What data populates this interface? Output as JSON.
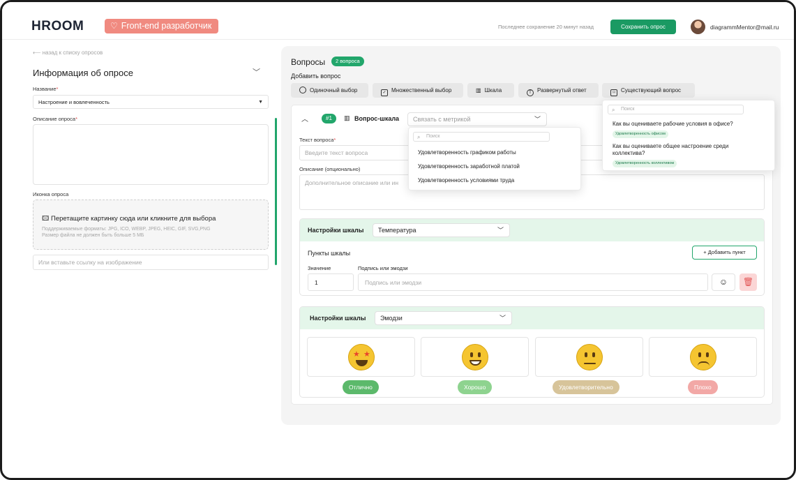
{
  "header": {
    "logo": "HRООМ",
    "project_badge": "Front-end разработчик",
    "last_save": "Последнее сохранение 20 минут назад",
    "save_button": "Сохранить опрос",
    "user_email": "diagrammMentor@mail.ru"
  },
  "sidebar": {
    "back_link": "назад к списку опросов",
    "section_title": "Информация об опросе",
    "name_label": "Название",
    "name_value": "Настроение и вовлеченность",
    "description_label": "Описание опроса",
    "icon_label": "Иконка опроса",
    "dropzone_title": "Перетащите картинку сюда или кликните для выбора",
    "dropzone_formats": "Поддерживаемые форматы: JPG, ICO, WEBP, JPEG, HEIC, GIF, SVG,PNG",
    "dropzone_size": "Размер файла не должен быть больше 5 МБ",
    "image_link_placeholder": "Или вставьте ссылку на изображение"
  },
  "questions": {
    "title": "Вопросы",
    "count_badge": "2 вопроса",
    "add_label": "Добавить вопрос",
    "types": [
      {
        "label": "Одиночный выбор",
        "icon": "radio-icon"
      },
      {
        "label": "Множественный выбор",
        "icon": "checkbox-icon"
      },
      {
        "label": "Шкала",
        "icon": "scale-icon"
      },
      {
        "label": "Развернутый ответ",
        "icon": "text-answer-icon"
      },
      {
        "label": "Существующий вопрос",
        "icon": "bookmark-icon"
      }
    ]
  },
  "question_card": {
    "number": "#1",
    "type_label": "Вопрос-шкала",
    "metric_placeholder": "Связать с метрикой",
    "text_label": "Текст вопроса",
    "text_placeholder": "Введите текст вопроса",
    "description_label": "Описание (опционально)",
    "description_placeholder": "Дополнительное описание или ин"
  },
  "scale_settings_1": {
    "label": "Настройки шкалы",
    "selected": "Температура",
    "points_label": "Пункты шкалы",
    "add_point_button": "+ Добавить пункт",
    "value_label": "Значение",
    "caption_label": "Подпись или эмодзи",
    "value": "1",
    "caption_placeholder": "Подпись или эмодзи"
  },
  "scale_settings_2": {
    "label": "Настройки шкалы",
    "selected": "Эмодзи",
    "options": [
      {
        "label": "Отлично",
        "face": "star-struck",
        "color": "#5cb96b"
      },
      {
        "label": "Хорошо",
        "face": "grinning",
        "color": "#8ed38f"
      },
      {
        "label": "Удовлетворительно",
        "face": "neutral",
        "color": "#d7c49a"
      },
      {
        "label": "Плохо",
        "face": "frowning",
        "color": "#f2a8a6"
      }
    ]
  },
  "metric_dropdown": {
    "search_placeholder": "Поиск",
    "items": [
      "Удовлетворенность графиком работы",
      "Удовлетворенность заработной платой",
      "Удовлетворенность условиями труда"
    ]
  },
  "existing_dropdown": {
    "search_placeholder": "Поиск",
    "items": [
      {
        "question": "Как вы оцениваете рабочие условия в офисе?",
        "tag": "Удовлетворенность офисом"
      },
      {
        "question": "Как вы оцениваете общее настроение среди коллектива?",
        "tag": "Удовлетворенность коллективом"
      }
    ]
  },
  "colors": {
    "accent": "#1a9a63",
    "project_badge": "#f08a80",
    "scale_header": "#e4f6ea"
  }
}
